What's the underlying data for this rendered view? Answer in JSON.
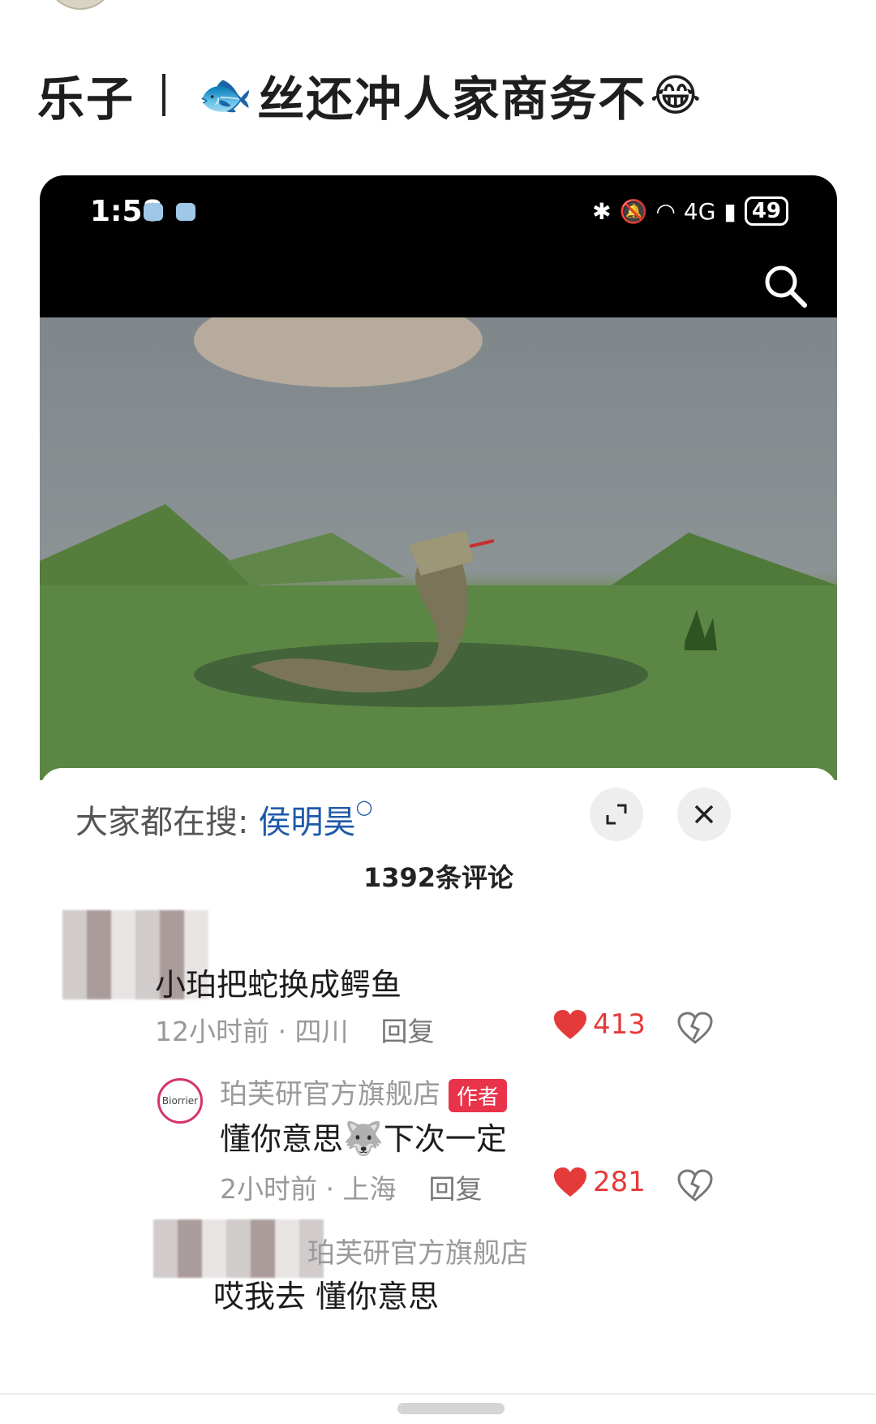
{
  "post": {
    "title_left": "乐子",
    "title_right": "丝还冲人家商务不"
  },
  "status_bar": {
    "time": "1:58",
    "network": "4G",
    "battery": "49"
  },
  "panel": {
    "hot_label": "大家都在搜:",
    "hot_keyword": "侯明昊",
    "comment_count": "1392条评论"
  },
  "comments": [
    {
      "text": "小珀把蛇换成鳄鱼",
      "time": "12小时前",
      "location": "四川",
      "reply": "回复",
      "likes": "413"
    },
    {
      "name": "珀芙研官方旗舰店",
      "tag": "作者",
      "avatar_text": "Biorrier",
      "text_a": "懂你意思",
      "text_b": "下次一定",
      "time": "2小时前",
      "location": "上海",
      "reply": "回复",
      "likes": "281"
    },
    {
      "name": "珀芙研官方旗舰店",
      "text": "哎我去 懂你意思"
    }
  ],
  "colors": {
    "accent_red": "#e53a3a",
    "keyword_blue": "#1e5aa8",
    "author_tag": "#e8334a"
  }
}
